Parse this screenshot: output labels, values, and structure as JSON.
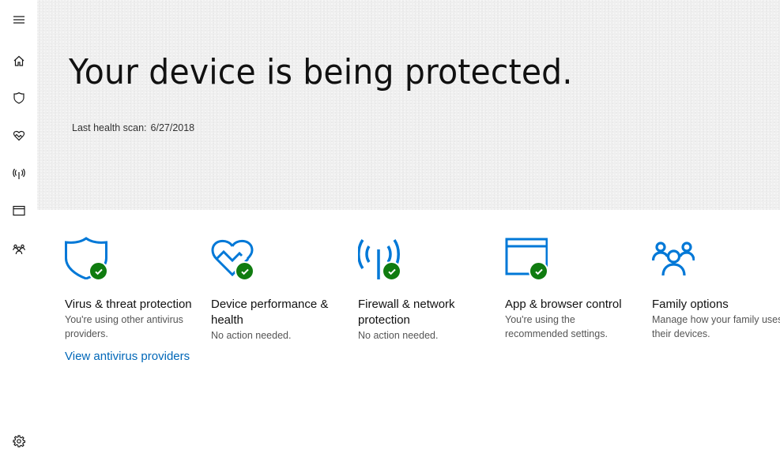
{
  "sidebar": {
    "items": [
      {
        "id": "menu",
        "icon": "hamburger-menu-icon",
        "label": "Menu"
      },
      {
        "id": "home",
        "icon": "home-icon",
        "label": "Home"
      },
      {
        "id": "virus",
        "icon": "shield-icon",
        "label": "Virus & threat protection"
      },
      {
        "id": "health",
        "icon": "heart-pulse-icon",
        "label": "Device performance & health"
      },
      {
        "id": "firewall",
        "icon": "antenna-icon",
        "label": "Firewall & network protection"
      },
      {
        "id": "app",
        "icon": "browser-window-icon",
        "label": "App & browser control"
      },
      {
        "id": "family",
        "icon": "family-icon",
        "label": "Family options"
      }
    ],
    "settings": {
      "icon": "gear-icon",
      "label": "Settings"
    }
  },
  "banner": {
    "title": "Your device is being protected.",
    "scan_label": "Last health scan:",
    "scan_date": "6/27/2018"
  },
  "colors": {
    "accent": "#0078d7",
    "link": "#0067b8",
    "ok_badge": "#107c10"
  },
  "tiles": [
    {
      "icon": "shield-icon",
      "status": "ok",
      "title": "Virus & threat protection",
      "description": "You're using other antivirus providers.",
      "link": "View antivirus providers"
    },
    {
      "icon": "heart-pulse-icon",
      "status": "ok",
      "title": "Device performance & health",
      "description": "No action needed."
    },
    {
      "icon": "antenna-icon",
      "status": "ok",
      "title": "Firewall & network protection",
      "description": "No action needed."
    },
    {
      "icon": "browser-window-icon",
      "status": "ok",
      "title": "App & browser control",
      "description": "You're using the recommended settings."
    },
    {
      "icon": "family-icon",
      "title": "Family options",
      "description": "Manage how your family uses their devices."
    }
  ]
}
